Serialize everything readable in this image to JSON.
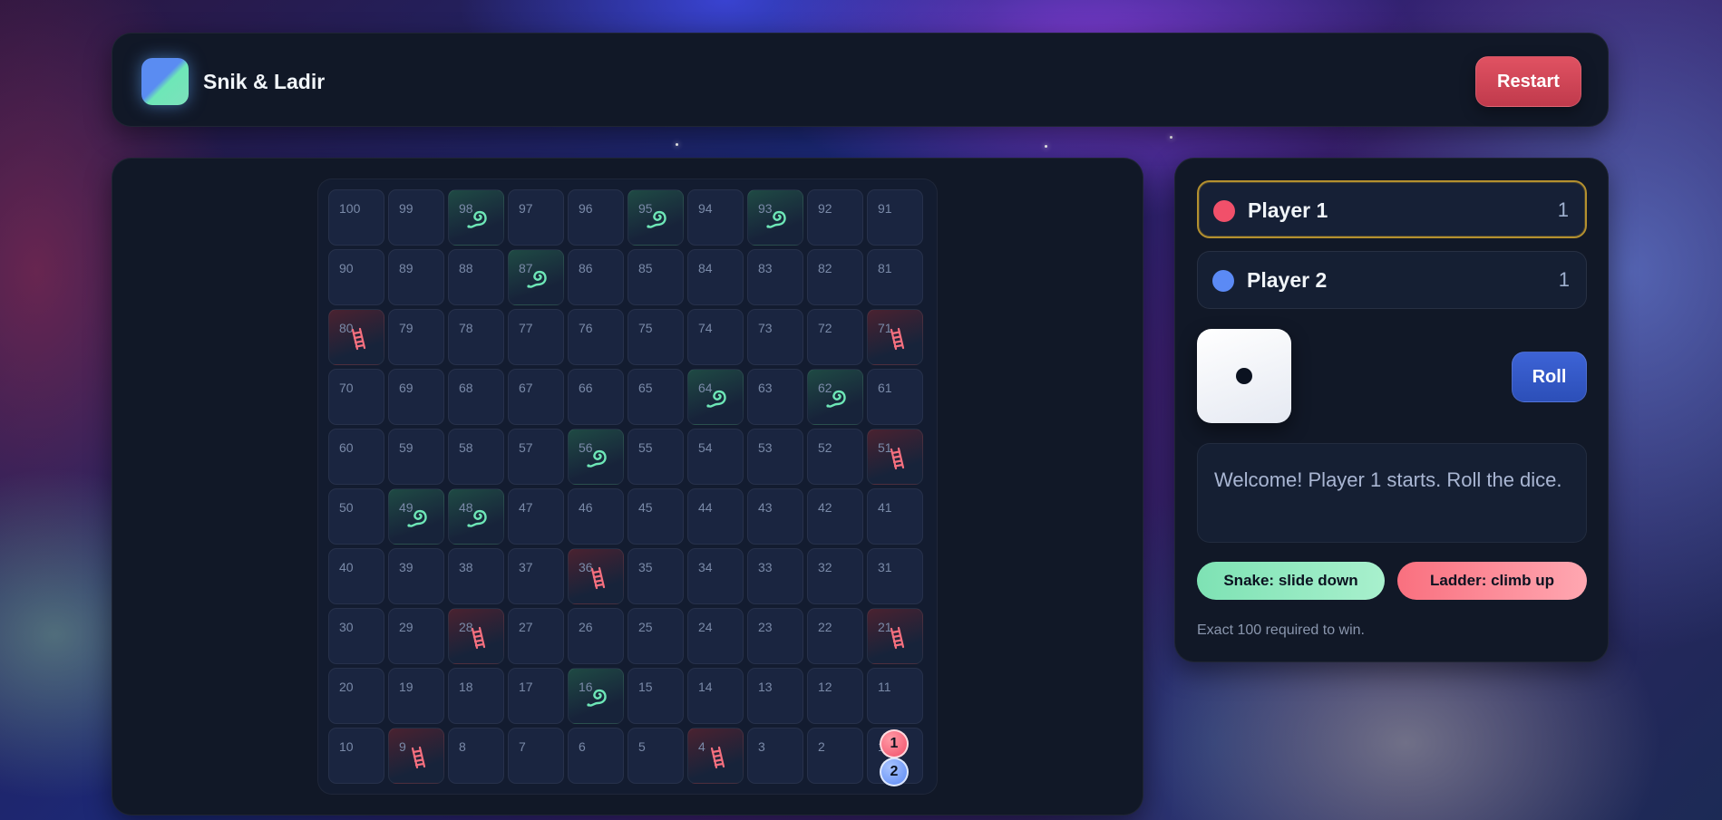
{
  "app": {
    "title": "Snik & Ladir",
    "restart_label": "Restart"
  },
  "board": {
    "rows": [
      [
        100,
        99,
        98,
        97,
        96,
        95,
        94,
        93,
        92,
        91
      ],
      [
        90,
        89,
        88,
        87,
        86,
        85,
        84,
        83,
        82,
        81
      ],
      [
        80,
        79,
        78,
        77,
        76,
        75,
        74,
        73,
        72,
        71
      ],
      [
        70,
        69,
        68,
        67,
        66,
        65,
        64,
        63,
        62,
        61
      ],
      [
        60,
        59,
        58,
        57,
        56,
        55,
        54,
        53,
        52,
        51
      ],
      [
        50,
        49,
        48,
        47,
        46,
        45,
        44,
        43,
        42,
        41
      ],
      [
        40,
        39,
        38,
        37,
        36,
        35,
        34,
        33,
        32,
        31
      ],
      [
        30,
        29,
        28,
        27,
        26,
        25,
        24,
        23,
        22,
        21
      ],
      [
        20,
        19,
        18,
        17,
        16,
        15,
        14,
        13,
        12,
        11
      ],
      [
        10,
        9,
        8,
        7,
        6,
        5,
        4,
        3,
        2,
        1
      ]
    ],
    "snake_cells": [
      98,
      95,
      93,
      87,
      64,
      62,
      56,
      49,
      48,
      16
    ],
    "ladder_cells": [
      80,
      71,
      51,
      36,
      28,
      21,
      9,
      4
    ],
    "snake_icon": "snake-icon",
    "ladder_icon": "ladder-icon"
  },
  "players": [
    {
      "name": "Player 1",
      "position": "1",
      "color": "#f1506a",
      "token_label": "1",
      "active": true
    },
    {
      "name": "Player 2",
      "position": "1",
      "color": "#5b8af5",
      "token_label": "2",
      "active": false
    }
  ],
  "dice": {
    "value": 1
  },
  "roll_label": "Roll",
  "message": "Welcome! Player 1 starts. Roll the dice.",
  "legend": {
    "snake": "Snake: slide down",
    "ladder": "Ladder: climb up"
  },
  "rule_note": "Exact 100 required to win.",
  "colors": {
    "snake": "#6ee7b7",
    "ladder": "#f6707f",
    "restart": "#d34a5a",
    "roll": "#3459c9",
    "active_border": "#b4902f"
  }
}
